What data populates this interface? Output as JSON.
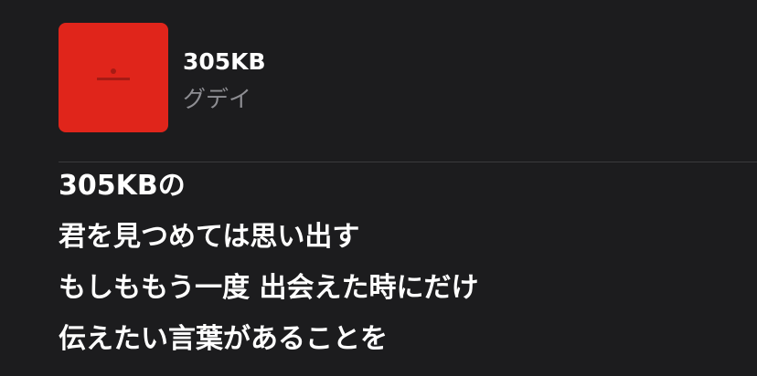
{
  "song": {
    "title": "305KB",
    "artist": "グデイ",
    "artwork_color": "#e0251b"
  },
  "lyrics": [
    "305KBの",
    "君を見つめては思い出す",
    "もしももう一度 出会えた時にだけ",
    "伝えたい言葉があることを"
  ],
  "colors": {
    "background": "#1c1c1e",
    "primary_text": "#ffffff",
    "secondary_text": "#8e8e93",
    "divider": "#3a3a3c"
  }
}
